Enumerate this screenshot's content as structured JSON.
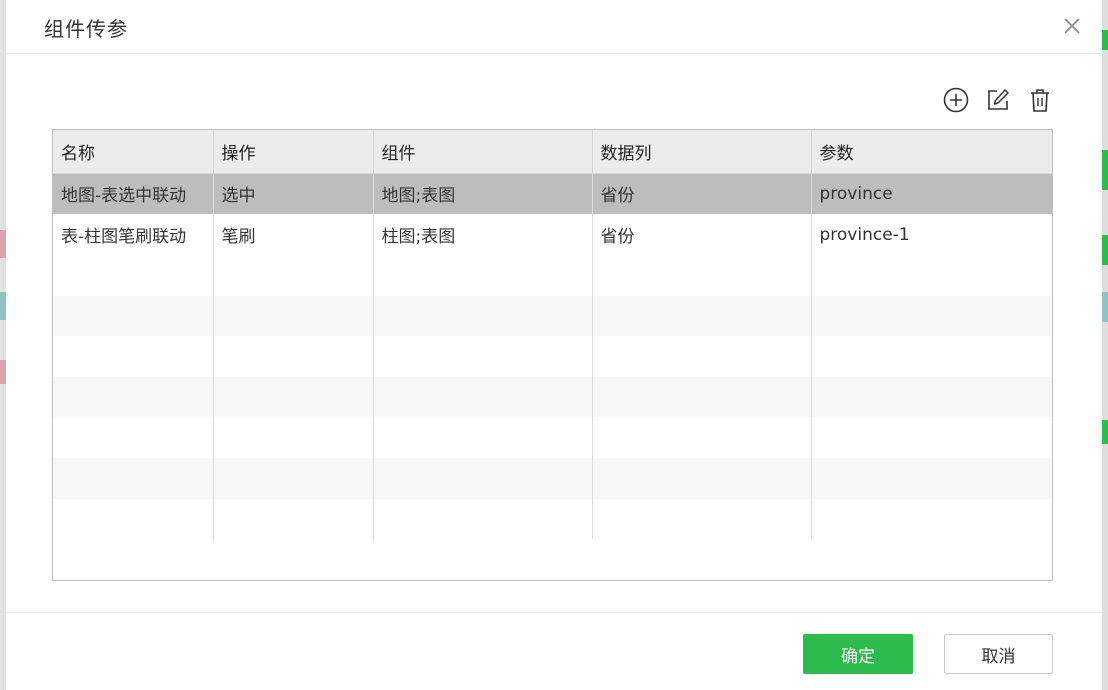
{
  "dialog": {
    "title": "组件传参",
    "ok_label": "确定",
    "cancel_label": "取消"
  },
  "toolbar": {
    "icons": [
      "add-circle-icon",
      "edit-icon",
      "trash-icon"
    ]
  },
  "table": {
    "columns": [
      "名称",
      "操作",
      "组件",
      "数据列",
      "参数"
    ],
    "rows": [
      [
        "地图-表选中联动",
        "选中",
        "地图;表图",
        "省份",
        "province"
      ],
      [
        "表-柱图笔刷联动",
        "笔刷",
        "柱图;表图",
        "省份",
        "province-1"
      ]
    ],
    "selected_row": 0
  },
  "colors": {
    "accent": "#2dbb4e",
    "selected_row": "#bdbdbd",
    "header_bg": "#ececec"
  }
}
